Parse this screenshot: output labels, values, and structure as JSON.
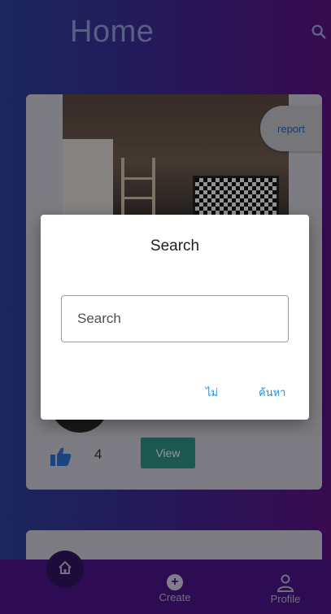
{
  "header": {
    "title": "Home",
    "search_icon": "search-icon"
  },
  "post": {
    "report_label": "report",
    "likes": "4",
    "view_label": "View",
    "like_icon": "thumbs-up-icon"
  },
  "dialog": {
    "title": "Search",
    "input_placeholder": "Search",
    "input_value": "",
    "cancel_label": "ไม่",
    "confirm_label": "ค้นหา"
  },
  "nav": {
    "items": [
      {
        "label": "",
        "icon": "home-icon"
      },
      {
        "label": "Create",
        "icon": "plus-circle-icon"
      },
      {
        "label": "Profile",
        "icon": "person-icon"
      }
    ]
  },
  "colors": {
    "accent_green": "#2f8f82",
    "link_blue": "#2b8fd8",
    "bottom_bar": "#4b1486"
  }
}
